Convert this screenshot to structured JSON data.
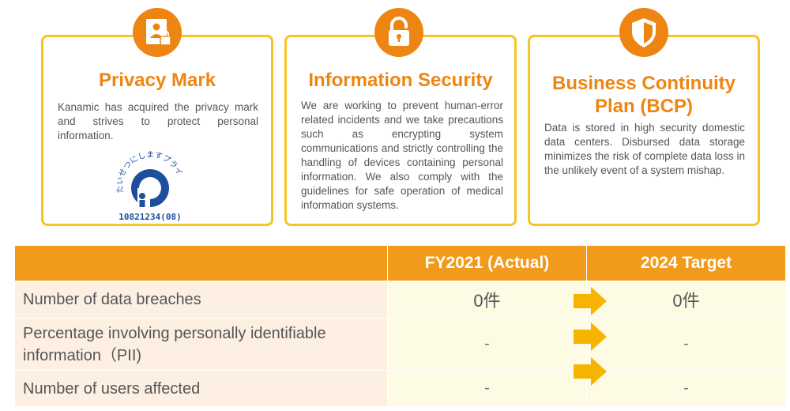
{
  "cards": [
    {
      "title": "Privacy Mark",
      "icon": "id-badge-lock-icon",
      "description": "Kanamic has acquired the privacy mark and strives to protect personal information.",
      "mark": {
        "arc_text": "たいせつにしますプライバシー",
        "number": "10821234(08)"
      }
    },
    {
      "title": "Information Security",
      "icon": "open-padlock-icon",
      "description": "We are working to prevent human-error related incidents and we take precautions such as encrypting system communications and strictly controlling the handling of devices containing personal information. We also comply with the guidelines for safe operation of medical information systems."
    },
    {
      "title_line1": "Business Continuity",
      "title_line2": "Plan (BCP)",
      "icon": "shield-icon",
      "description": "Data is stored in high security domestic data centers. Disbursed data storage minimizes the risk of complete data loss in the unlikely event of a system mishap."
    }
  ],
  "table": {
    "headers": [
      "",
      "FY2021 (Actual)",
      "2024 Target"
    ],
    "rows": [
      {
        "label": "Number of data breaches",
        "actual": "0件",
        "target": "0件"
      },
      {
        "label_line1": "Percentage involving personally identifiable",
        "label_line2": "information（PII)",
        "actual": "-",
        "target": "-"
      },
      {
        "label": "Number of users affected",
        "actual": "-",
        "target": "-"
      }
    ]
  },
  "colors": {
    "accent": "#ee8512",
    "card_border": "#f7c325",
    "header_bg": "#f29a1b",
    "label_bg": "#fdf0e3",
    "value_bg": "#fdfbe4",
    "arrow": "#f6b400",
    "mark_blue": "#1e4f9c"
  }
}
